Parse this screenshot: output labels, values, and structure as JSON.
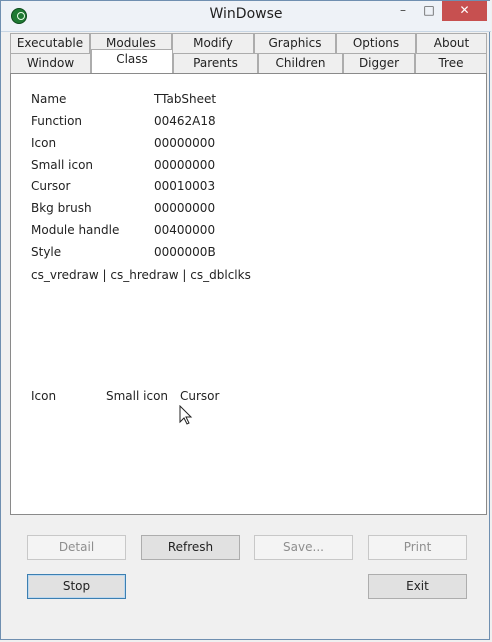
{
  "window": {
    "title": "WinDowse",
    "minimize_label": "–",
    "maximize_label": "□",
    "close_label": "✕"
  },
  "tabs_row1": [
    {
      "label": "Executable"
    },
    {
      "label": "Modules"
    },
    {
      "label": "Modify"
    },
    {
      "label": "Graphics"
    },
    {
      "label": "Options"
    },
    {
      "label": "About"
    }
  ],
  "tabs_row2": [
    {
      "label": "Window"
    },
    {
      "label": "Class"
    },
    {
      "label": "Parents"
    },
    {
      "label": "Children"
    },
    {
      "label": "Digger"
    },
    {
      "label": "Tree"
    }
  ],
  "active_tab": "Class",
  "class_info": {
    "rows": [
      {
        "label": "Name",
        "value": "TTabSheet"
      },
      {
        "label": "Function",
        "value": "00462A18"
      },
      {
        "label": "Icon",
        "value": "00000000"
      },
      {
        "label": "Small icon",
        "value": "00000000"
      },
      {
        "label": "Cursor",
        "value": "00010003"
      },
      {
        "label": "Bkg brush",
        "value": "00000000"
      },
      {
        "label": "Module handle",
        "value": "00400000"
      },
      {
        "label": "Style",
        "value": "0000000B"
      }
    ],
    "style_flags": "cs_vredraw | cs_hredraw | cs_dblclks",
    "icon_section_labels": {
      "icon": "Icon",
      "small_icon": "Small icon",
      "cursor": "Cursor"
    }
  },
  "buttons": {
    "detail": "Detail",
    "refresh": "Refresh",
    "save": "Save...",
    "print": "Print",
    "stop": "Stop",
    "exit": "Exit"
  }
}
